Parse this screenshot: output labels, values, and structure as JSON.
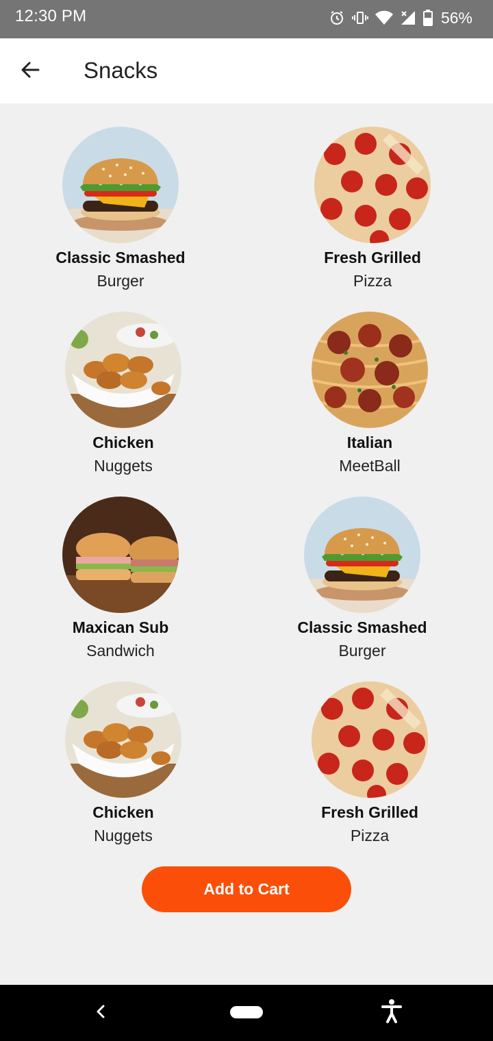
{
  "status": {
    "time": "12:30 PM",
    "battery": "56%",
    "icons": [
      "alarm-icon",
      "vibrate-icon",
      "wifi-icon",
      "signal-icon",
      "battery-icon"
    ]
  },
  "header": {
    "title": "Snacks",
    "back_icon": "arrow-left-icon"
  },
  "items": [
    {
      "name": "Classic Smashed",
      "sub": "Burger",
      "image": "burger"
    },
    {
      "name": "Fresh Grilled",
      "sub": "Pizza",
      "image": "pizza"
    },
    {
      "name": "Chicken",
      "sub": "Nuggets",
      "image": "nuggets"
    },
    {
      "name": "Italian",
      "sub": "MeetBall",
      "image": "meatball"
    },
    {
      "name": "Maxican Sub",
      "sub": "Sandwich",
      "image": "sandwich"
    },
    {
      "name": "Classic Smashed",
      "sub": "Burger",
      "image": "burger"
    },
    {
      "name": "Chicken",
      "sub": "Nuggets",
      "image": "nuggets"
    },
    {
      "name": "Fresh Grilled",
      "sub": "Pizza",
      "image": "pizza"
    }
  ],
  "cart": {
    "label": "Add to Cart",
    "color": "#fb4f09"
  },
  "navigation": {
    "icons": [
      "nav-back-icon",
      "home-pill-icon",
      "accessibility-icon"
    ]
  }
}
